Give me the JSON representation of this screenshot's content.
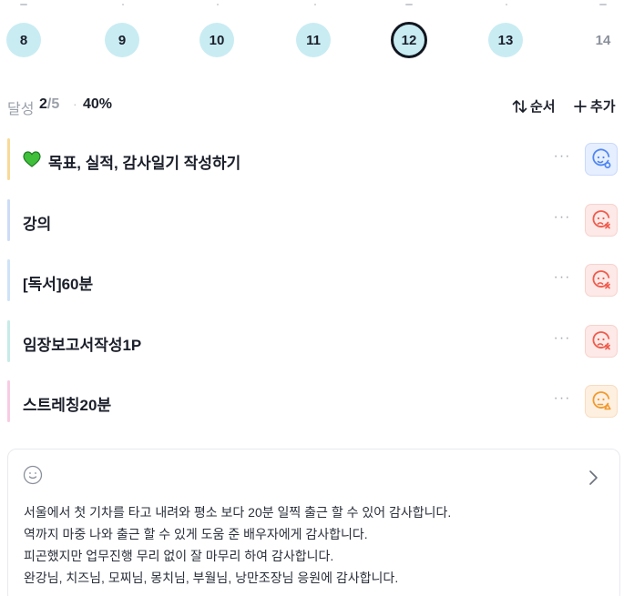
{
  "calendar": {
    "days": [
      {
        "label": "8",
        "style": "circle"
      },
      {
        "label": "9",
        "style": "circle"
      },
      {
        "label": "10",
        "style": "circle"
      },
      {
        "label": "11",
        "style": "circle"
      },
      {
        "label": "12",
        "style": "selected"
      },
      {
        "label": "13",
        "style": "circle"
      },
      {
        "label": "14",
        "style": "plain"
      }
    ],
    "selected": "12",
    "accent_color": "#c9ecf3"
  },
  "summary": {
    "label": "달성",
    "done": "2",
    "total": "/5",
    "separator": "·",
    "percent": "40%",
    "sort_label": "순서",
    "add_label": "추가"
  },
  "tasks": [
    {
      "title": "목표, 실적, 감사일기 작성하기",
      "emoji": "💚",
      "bar_color": "#f9d998",
      "status": "blue",
      "status_icon": "smile-badge-icon"
    },
    {
      "title": "강의",
      "bar_color": "#cddcf6",
      "status": "red",
      "status_icon": "sad-x-icon"
    },
    {
      "title": "[독서]60분",
      "bar_color": "#cfe3f7",
      "status": "red",
      "status_icon": "sad-x-icon"
    },
    {
      "title": "임장보고서작성1P",
      "bar_color": "#c7ebe8",
      "status": "red",
      "status_icon": "sad-x-icon"
    },
    {
      "title": "스트레칭20분",
      "bar_color": "#f7cde3",
      "status": "orange",
      "status_icon": "meh-triangle-icon"
    }
  ],
  "more_label": "···",
  "gratitude": {
    "icon": "smile-icon",
    "lines": [
      "서울에서 첫 기차를 타고 내려와 평소 보다 20분 일찍 출근 할 수 있어 감사합니다.",
      "역까지 마중 나와 출근 할 수 있게 도움 준 배우자에게 감사합니다.",
      "피곤했지만 업무진행 무리 없이 잘 마무리 하여 감사합니다.",
      "완강님, 치즈님, 모찌님, 몽치님, 부월님, 낭만조장님 응원에 감사합니다."
    ]
  }
}
